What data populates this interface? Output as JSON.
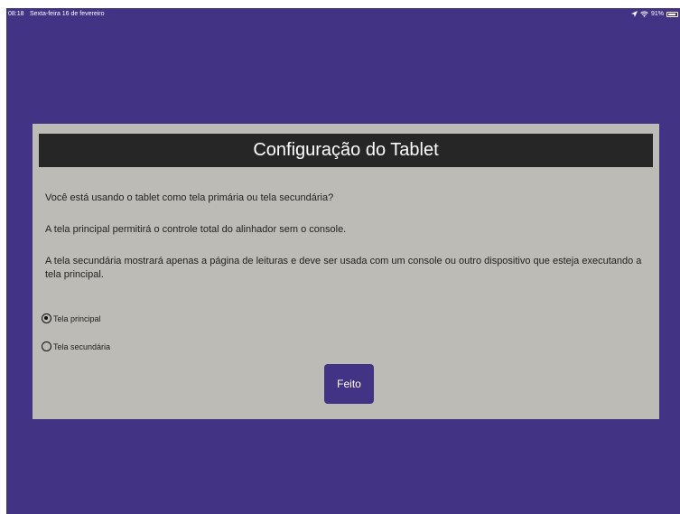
{
  "status_bar": {
    "time": "08:18",
    "date": "Sexta-feira 16 de fevereiro",
    "battery": "91%",
    "battery_level": 0.91
  },
  "dialog": {
    "title": "Configuração do Tablet",
    "question": "Você está usando o tablet como tela primária ou tela secundária?",
    "primary_description": "A tela principal permitirá o controle total do alinhador sem o console.",
    "secondary_description": "A tela secundária mostrará apenas a página de leituras e deve ser usada com um console ou outro dispositivo que esteja executando a tela principal.",
    "options": [
      {
        "label": "Tela principal",
        "selected": true
      },
      {
        "label": "Tela secundária",
        "selected": false
      }
    ],
    "done_label": "Feito"
  },
  "colors": {
    "background": "#433384",
    "dialog": "#bcbbb6",
    "header": "#262626",
    "button": "#433384"
  },
  "icons": [
    "location-arrow-icon",
    "wifi-icon",
    "battery-icon",
    "radio-selected-icon",
    "radio-unselected-icon"
  ]
}
